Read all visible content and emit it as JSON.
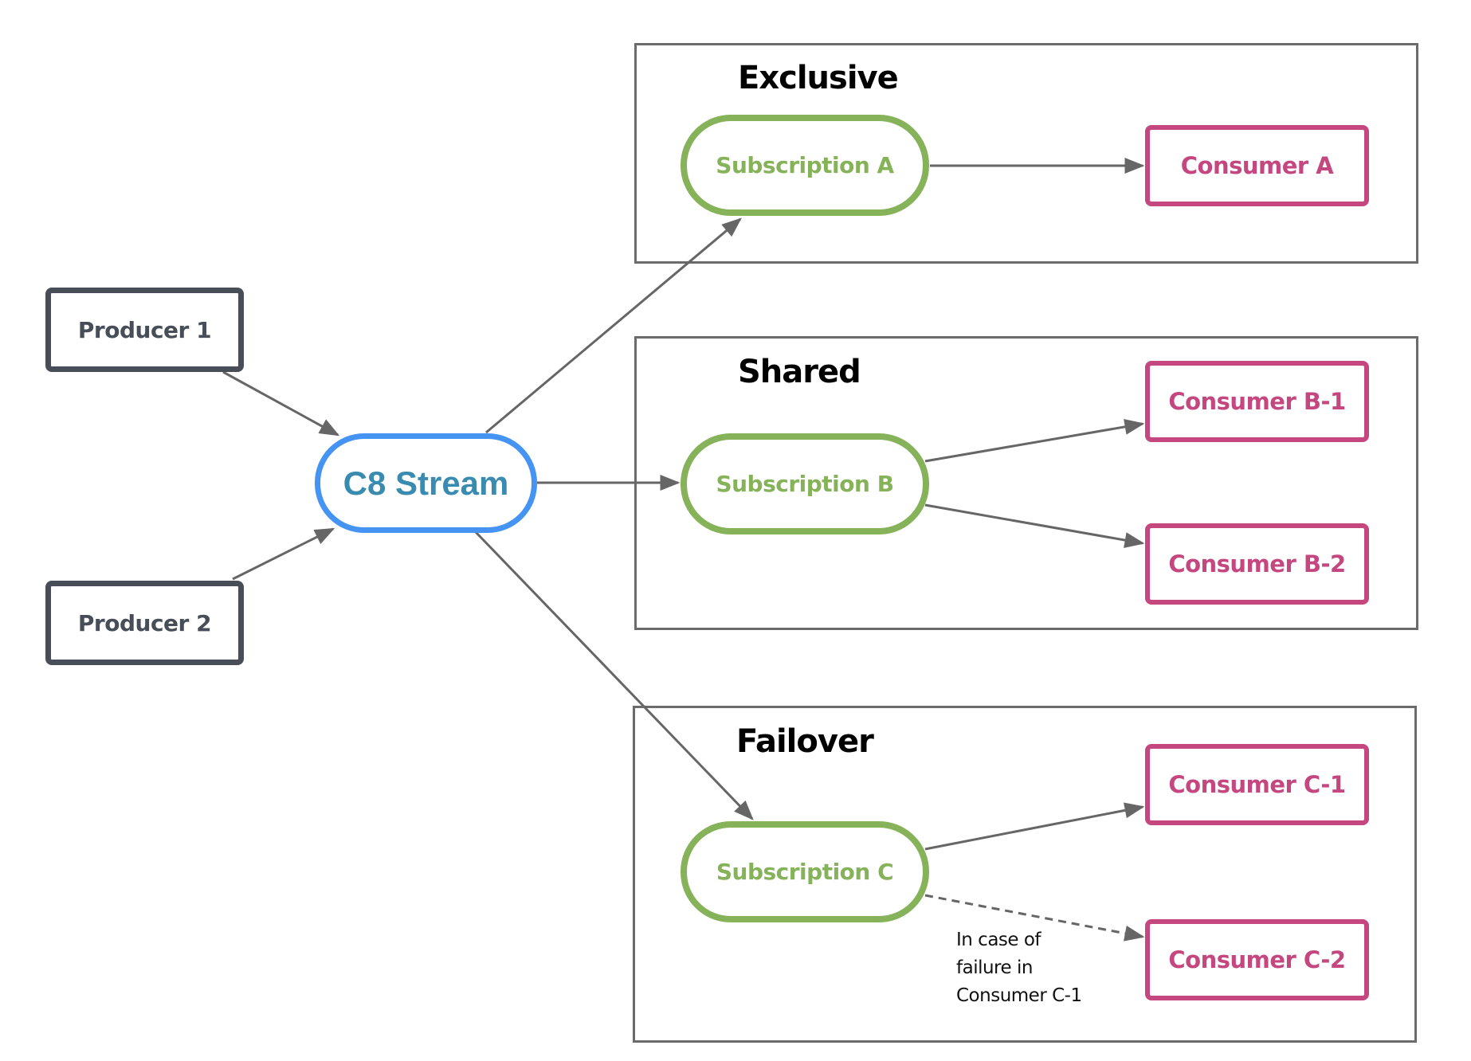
{
  "colors": {
    "producer": "#474e57",
    "stream": "#4593f3",
    "stream_text": "#3a8bb0",
    "subscription": "#86b35a",
    "consumer": "#c5477f",
    "edge": "#666666",
    "group_border": "#6b6b6b"
  },
  "producers": [
    {
      "id": "producer-1",
      "label": "Producer 1"
    },
    {
      "id": "producer-2",
      "label": "Producer 2"
    }
  ],
  "stream": {
    "id": "c8-stream",
    "label": "C8 Stream"
  },
  "groups": [
    {
      "id": "exclusive",
      "title": "Exclusive",
      "subscription": {
        "id": "subscription-a",
        "label": "Subscription A"
      },
      "consumers": [
        {
          "id": "consumer-a",
          "label": "Consumer A"
        }
      ]
    },
    {
      "id": "shared",
      "title": "Shared",
      "subscription": {
        "id": "subscription-b",
        "label": "Subscription B"
      },
      "consumers": [
        {
          "id": "consumer-b-1",
          "label": "Consumer B-1"
        },
        {
          "id": "consumer-b-2",
          "label": "Consumer B-2"
        }
      ]
    },
    {
      "id": "failover",
      "title": "Failover",
      "subscription": {
        "id": "subscription-c",
        "label": "Subscription C"
      },
      "consumers": [
        {
          "id": "consumer-c-1",
          "label": "Consumer C-1"
        },
        {
          "id": "consumer-c-2",
          "label": "Consumer C-2"
        }
      ],
      "note": "In case of\nfailure in\nConsumer C-1"
    }
  ],
  "edges": [
    {
      "from": "producer-1",
      "to": "c8-stream",
      "style": "solid"
    },
    {
      "from": "producer-2",
      "to": "c8-stream",
      "style": "solid"
    },
    {
      "from": "c8-stream",
      "to": "subscription-a",
      "style": "solid"
    },
    {
      "from": "c8-stream",
      "to": "subscription-b",
      "style": "solid"
    },
    {
      "from": "c8-stream",
      "to": "subscription-c",
      "style": "solid"
    },
    {
      "from": "subscription-a",
      "to": "consumer-a",
      "style": "solid"
    },
    {
      "from": "subscription-b",
      "to": "consumer-b-1",
      "style": "solid"
    },
    {
      "from": "subscription-b",
      "to": "consumer-b-2",
      "style": "solid"
    },
    {
      "from": "subscription-c",
      "to": "consumer-c-1",
      "style": "solid"
    },
    {
      "from": "subscription-c",
      "to": "consumer-c-2",
      "style": "dashed"
    }
  ]
}
